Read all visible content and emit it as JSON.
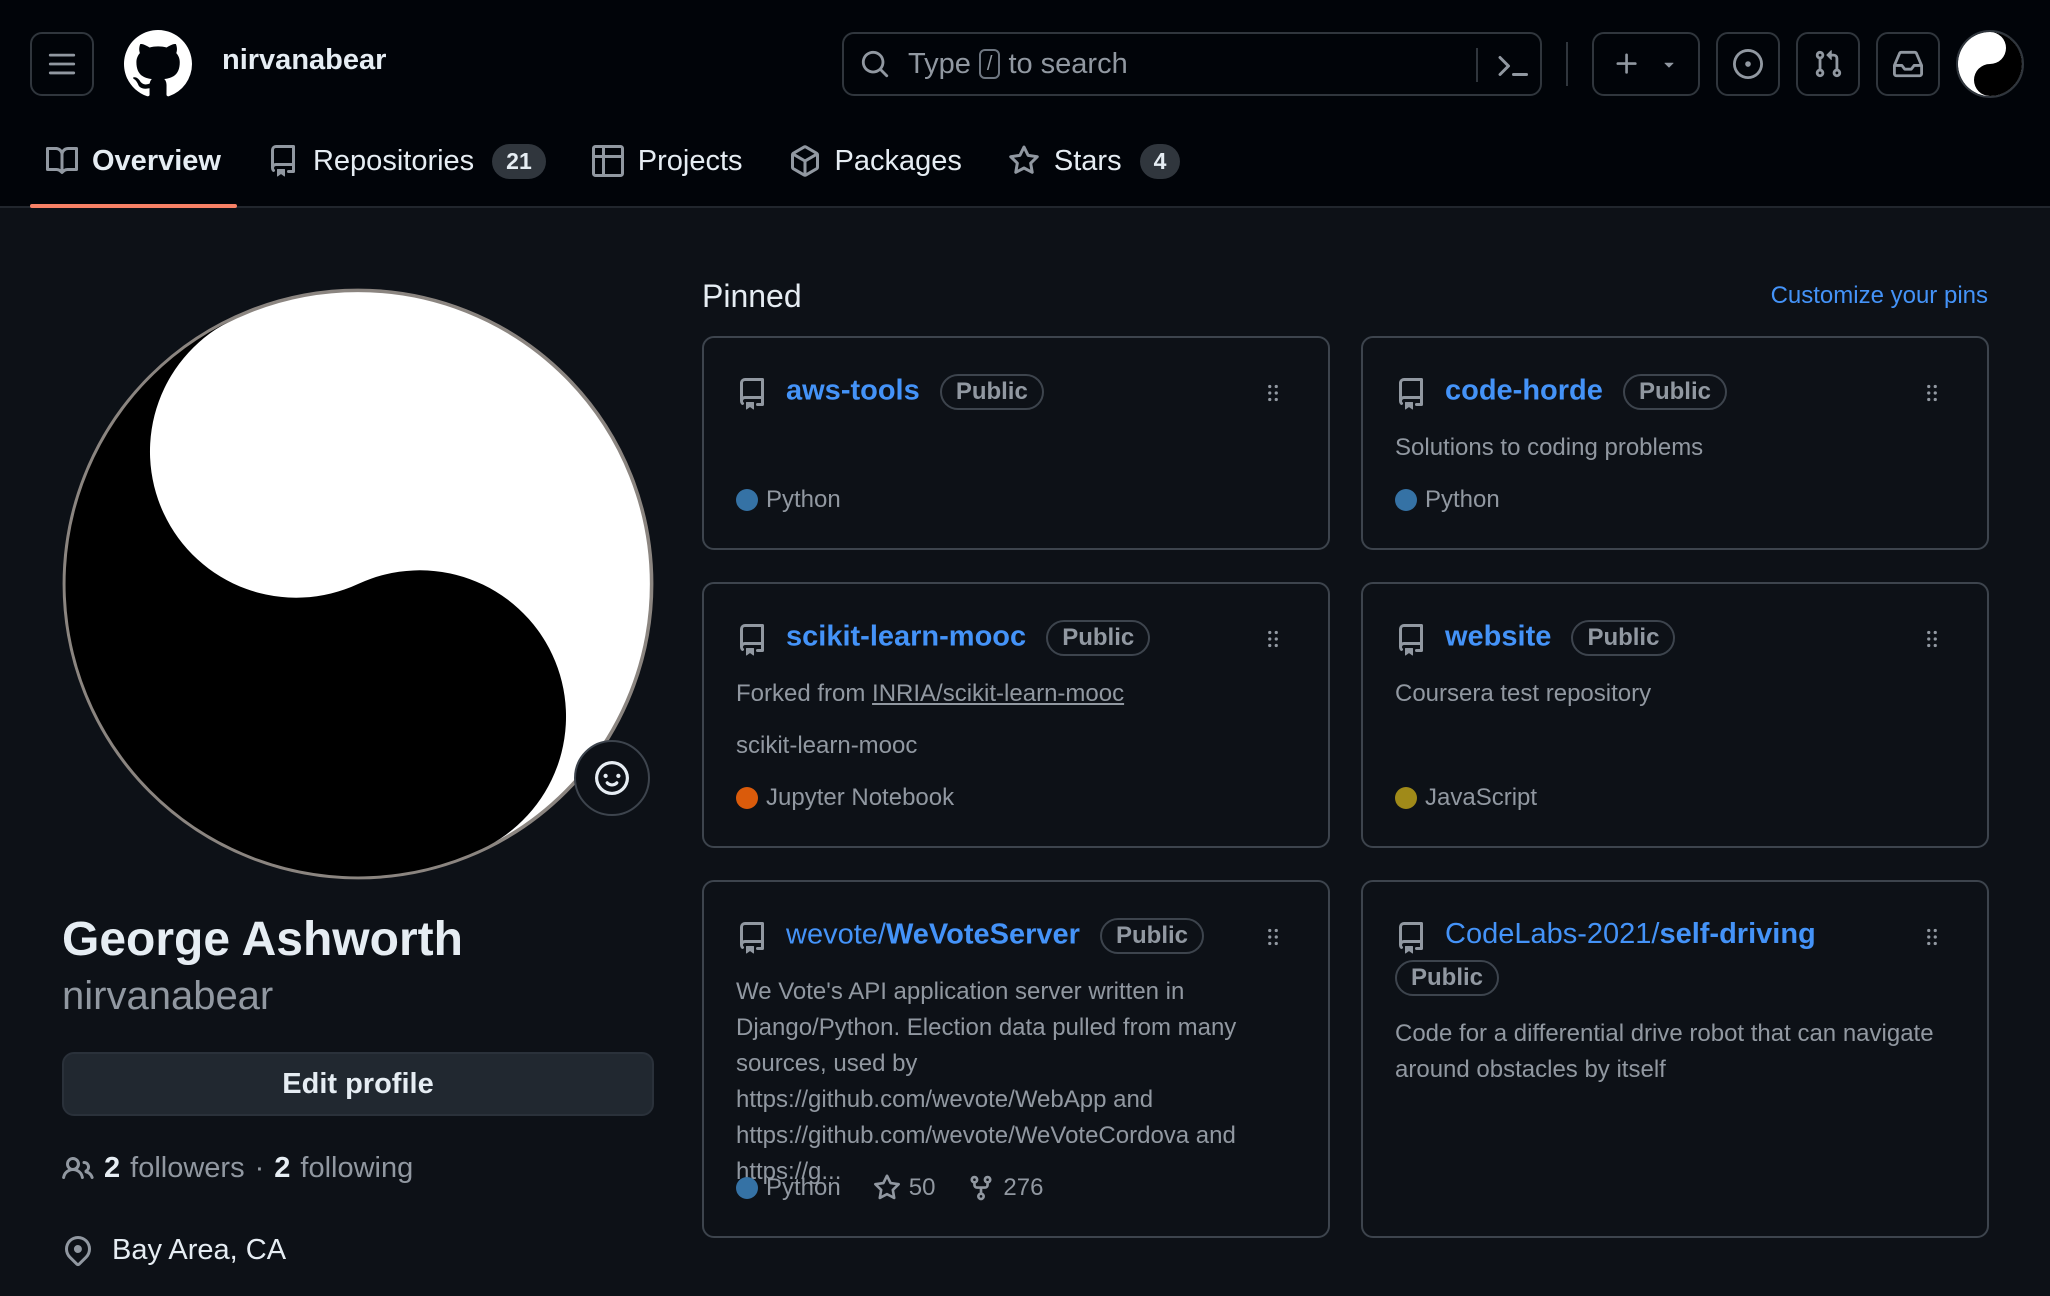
{
  "header": {
    "username": "nirvanabear",
    "search": {
      "prefix": "Type",
      "key": "/",
      "suffix": "to search"
    }
  },
  "tabs": [
    {
      "label": "Overview",
      "count": null,
      "active": true,
      "icon": "book-icon"
    },
    {
      "label": "Repositories",
      "count": "21",
      "active": false,
      "icon": "repo-icon"
    },
    {
      "label": "Projects",
      "count": null,
      "active": false,
      "icon": "table-icon"
    },
    {
      "label": "Packages",
      "count": null,
      "active": false,
      "icon": "package-icon"
    },
    {
      "label": "Stars",
      "count": "4",
      "active": false,
      "icon": "star-icon"
    }
  ],
  "profile": {
    "full_name": "George Ashworth",
    "login": "nirvanabear",
    "edit_label": "Edit profile",
    "followers_count": "2",
    "followers_label": "followers",
    "separator": "·",
    "following_count": "2",
    "following_label": "following",
    "location": "Bay Area, CA"
  },
  "pinned": {
    "title": "Pinned",
    "customize_label": "Customize your pins",
    "badge_label": "Public",
    "cards": [
      {
        "name": "aws-tools",
        "language": "Python",
        "language_color": "#3572A5"
      },
      {
        "name": "code-horde",
        "description": "Solutions to coding problems",
        "language": "Python",
        "language_color": "#3572A5"
      },
      {
        "name": "scikit-learn-mooc",
        "forked_prefix": "Forked from",
        "forked_from": "INRIA/scikit-learn-mooc",
        "description": "scikit-learn-mooc",
        "language": "Jupyter Notebook",
        "language_color": "#DA5B0B"
      },
      {
        "name": "website",
        "description": "Coursera test repository",
        "language": "JavaScript",
        "language_color": "#A08A19"
      },
      {
        "owner": "wevote/",
        "name": "WeVoteServer",
        "description": "We Vote's API application server written in Django/Python. Election data pulled from many sources, used by https://github.com/wevote/WebApp and https://github.com/wevote/WeVoteCordova and https://g...",
        "language": "Python",
        "language_color": "#3572A5",
        "stars": "50",
        "forks": "276"
      },
      {
        "owner": "CodeLabs-2021/",
        "name": "self-driving",
        "description": "Code for a differential drive robot that can navigate around obstacles by itself"
      }
    ]
  },
  "colors": {
    "accent_link": "#4493f8",
    "tab_underline": "#f78166",
    "background": "#0d1117",
    "header_background": "#010409"
  }
}
